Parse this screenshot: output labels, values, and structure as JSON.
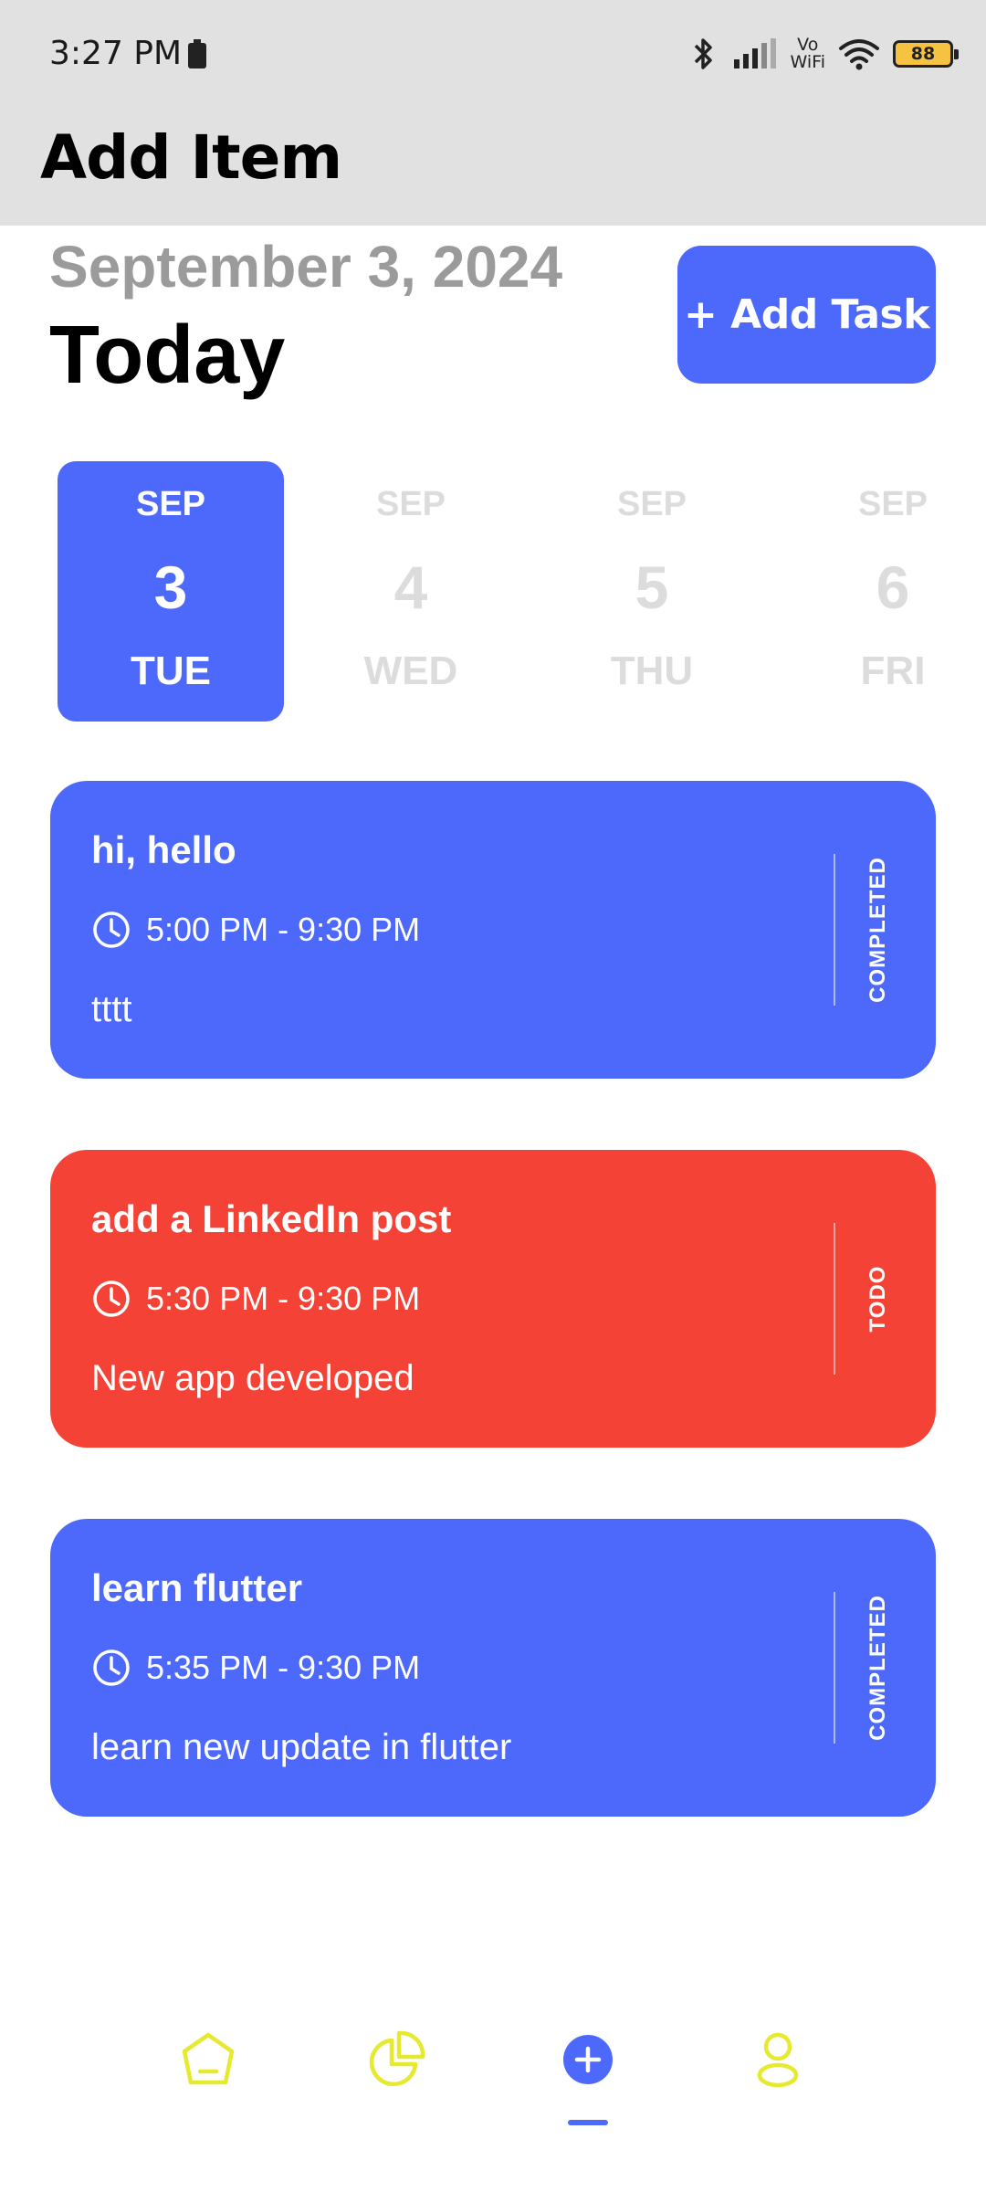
{
  "status_bar": {
    "time": "3:27 PM",
    "vowifi_line1": "Vo",
    "vowifi_line2": "WiFi",
    "battery": "88"
  },
  "app_bar": {
    "title": "Add Item"
  },
  "header": {
    "date": "September 3, 2024",
    "today_label": "Today",
    "add_task_label": "+ Add Task"
  },
  "date_picker": {
    "days": [
      {
        "month": "SEP",
        "day": "3",
        "weekday": "TUE",
        "selected": true
      },
      {
        "month": "SEP",
        "day": "4",
        "weekday": "WED",
        "selected": false
      },
      {
        "month": "SEP",
        "day": "5",
        "weekday": "THU",
        "selected": false
      },
      {
        "month": "SEP",
        "day": "6",
        "weekday": "FRI",
        "selected": false
      }
    ]
  },
  "tasks": [
    {
      "title": "hi, hello",
      "time": "5:00 PM - 9:30 PM",
      "note": "tttt",
      "status": "COMPLETED",
      "color": "#4c69fb"
    },
    {
      "title": "add a LinkedIn post",
      "time": "5:30 PM - 9:30 PM",
      "note": "New app developed",
      "status": "TODO",
      "color": "#f44336"
    },
    {
      "title": "learn flutter",
      "time": "5:35 PM - 9:30 PM",
      "note": "learn new update in flutter",
      "status": "COMPLETED",
      "color": "#4c69fb"
    }
  ],
  "bottom_nav": {
    "items": [
      "home-icon",
      "pie-chart-icon",
      "add-icon",
      "profile-icon"
    ],
    "active_index": 2,
    "icon_color": "#e6ea2e",
    "active_color": "#4c69fb"
  },
  "colors": {
    "accent": "#4c69fb",
    "todo": "#f44336",
    "appbar": "#e1e1e1"
  }
}
